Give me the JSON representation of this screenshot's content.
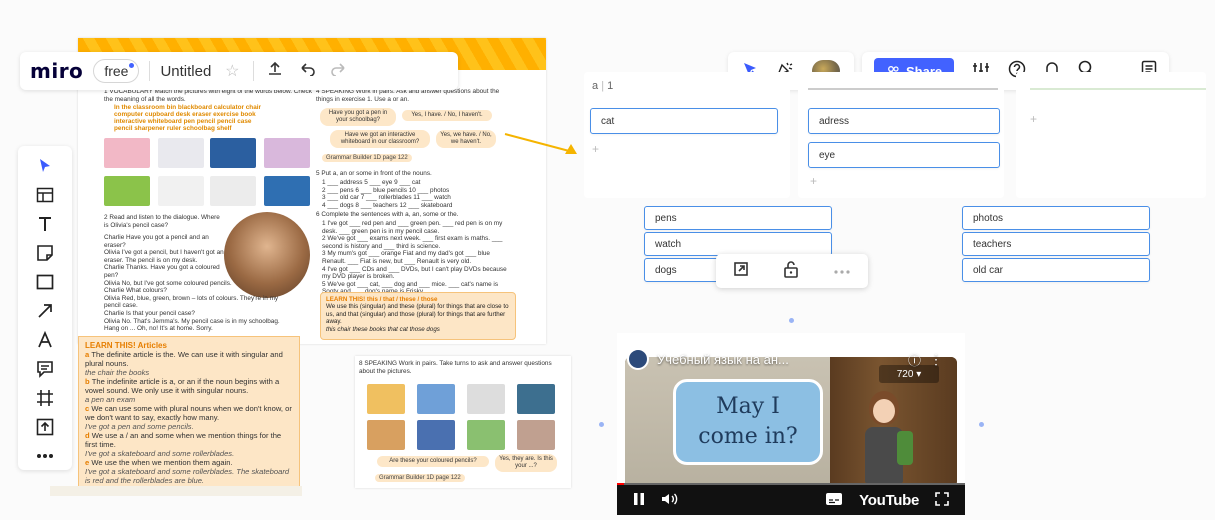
{
  "topbar": {
    "logo": "miro",
    "plan": "free",
    "board_title": "Untitled",
    "star_icon": "star-icon",
    "upload_icon": "upload-icon",
    "undo_icon": "undo-icon",
    "redo_icon": "redo-icon"
  },
  "right_toolbar": {
    "share_label": "Share",
    "icons": [
      "cursor-icon",
      "celebrate-icon",
      "avatar",
      "settings-sliders-icon",
      "help-icon",
      "bell-icon",
      "search-icon",
      "notes-icon"
    ]
  },
  "left_toolbar": {
    "tools": [
      "select-cursor-icon",
      "templates-icon",
      "text-icon",
      "sticky-note-icon",
      "shape-icon",
      "pen-icon",
      "line-icon",
      "comment-icon",
      "frame-icon",
      "upload-icon",
      "more-icon"
    ]
  },
  "textbook": {
    "ex1_title": "1 VOCABULARY Match the pictures with eight of the words below. Check the meaning of all the words.",
    "ex1_words_line1": "In the classroom  bin  blackboard  calculator  chair",
    "ex1_words_line2": "computer  cupboard  desk  eraser  exercise book",
    "ex1_words_line3": "interactive whiteboard  pen  pencil  pencil case",
    "ex1_words_line4": "pencil sharpener  ruler  schoolbag  shelf",
    "ex2_title": "2 Read and listen to the dialogue. Where is Olivia's pencil case?",
    "dialogue": [
      "Charlie  Have you got a pencil and an eraser?",
      "Olivia  I've got a pencil, but I haven't got an eraser. The pencil is on my desk.",
      "Charlie  Thanks. Have you got a coloured pen?",
      "Olivia  No, but I've got some coloured pencils.",
      "Charlie  What colours?",
      "Olivia  Red, blue, green, brown – lots of colours. They're in my pencil case.",
      "Charlie  Is that your pencil case?",
      "Olivia  No. That's Jemma's. My pencil case is in my schoolbag. Hang on ... Oh, no! It's at home. Sorry."
    ],
    "ex4_title": "4 SPEAKING Work in pairs. Ask and answer questions about the things in exercise 1. Use a or an.",
    "bubble1": "Have you got a pen in your schoolbag?",
    "bubble2": "Yes, I have. / No, I haven't.",
    "bubble3": "Have we got an interactive whiteboard in our classroom?",
    "bubble4": "Yes, we have. / No, we haven't.",
    "grammar_builder": "Grammar Builder 1D page 122",
    "ex5_title": "5 Put a, an or some in front of the nouns.",
    "ex5_items": [
      "1 ___ address  5 ___ eye  9 ___ cat",
      "2 ___ pens  6 ___ blue pencils  10 ___ photos",
      "3 ___ old car  7 ___ rollerblades  11 ___ watch",
      "4 ___ dogs  8 ___ teachers  12 ___ skateboard"
    ],
    "ex6_title": "6 Complete the sentences with a, an, some or the.",
    "ex6_items": [
      "1 I've got ___ red pen and ___ green pen. ___ red pen is on my desk. ___ green pen is in my pencil case.",
      "2 We've got ___ exams next week. ___ first exam is maths. ___ second is history and ___ third is science.",
      "3 My mum's got ___ orange Fiat and my dad's got ___ blue Renault. ___ Fiat is new, but ___ Renault is very old.",
      "4 I've got ___ CDs and ___ DVDs, but I can't play DVDs because my DVD player is broken.",
      "5 We've got ___ cat, ___ dog and ___ mice. ___ cat's name is Sooty and ___ dog's name is Frisky."
    ],
    "learn2_title": "LEARN THIS! this / that / these / those",
    "learn2_text": "We use this (singular) and these (plural) for things that are close to us, and that (singular) and those (plural) for things that are further away.",
    "learn2_example": "this chair   these books   that cat   those dogs",
    "learn_title": "LEARN THIS! Articles",
    "learn_items": [
      {
        "k": "a",
        "t": "The definite article is the. We can use it with singular and plural nouns.",
        "e": "the chair   the books"
      },
      {
        "k": "b",
        "t": "The indefinite article is a, or an if the noun begins with a vowel sound. We only use it with singular nouns.",
        "e": "a pen   an exam"
      },
      {
        "k": "c",
        "t": "We can use some with plural nouns when we don't know, or we don't want to say, exactly how many.",
        "e": "I've got a pen and some pencils."
      },
      {
        "k": "d",
        "t": "We use a / an and some when we mention things for the first time.",
        "e": "I've got a skateboard and some rollerblades."
      },
      {
        "k": "e",
        "t": "We use the when we mention them again.",
        "e": "I've got a skateboard and some rollerblades. The skateboard is red and the rollerblades are blue."
      }
    ],
    "ex8_title": "8 SPEAKING Work in pairs. Take turns to ask and answer questions about the pictures.",
    "ex8_bubble1": "Are these your coloured pencils?",
    "ex8_bubble2": "Yes, they are. Is this your ...?",
    "ex8_grammar": "Grammar Builder 1D page 122"
  },
  "kanban": {
    "col1_header": "a",
    "col1_count": "1",
    "col1_cards": [
      "cat"
    ],
    "col2_cards": [
      "adress",
      "eye"
    ],
    "group_left": [
      "pens",
      "watch",
      "dogs"
    ],
    "group_right": [
      "photos",
      "teachers",
      "old car"
    ]
  },
  "floating_toolbar": {
    "icons": [
      "open-link-icon",
      "lock-icon",
      "more-icon"
    ]
  },
  "video": {
    "title": "Учебный язык на ан...",
    "bubble_text_line1": "May I",
    "bubble_text_line2": "come in?",
    "quality": "720",
    "youtube_label": "YouTube",
    "progress": 0.02
  }
}
